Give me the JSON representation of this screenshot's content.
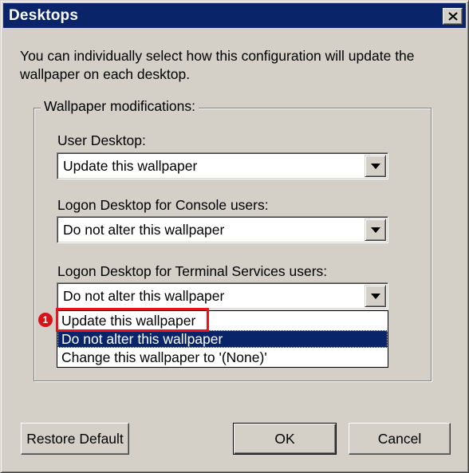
{
  "window": {
    "title": "Desktops"
  },
  "description": "You can individually select how this configuration will update the wallpaper on each desktop.",
  "group": {
    "label": "Wallpaper modifications:"
  },
  "fields": [
    {
      "label": "User Desktop:",
      "value": "Update this wallpaper"
    },
    {
      "label": "Logon Desktop for Console users:",
      "value": "Do not alter this wallpaper"
    },
    {
      "label": "Logon Desktop for Terminal Services users:",
      "value": "Do not alter this wallpaper"
    }
  ],
  "dropdown": {
    "options": [
      "Update this wallpaper",
      "Do not alter this wallpaper",
      "Change this wallpaper to '(None)'"
    ],
    "selected": "Do not alter this wallpaper",
    "highlighted": "Update this wallpaper"
  },
  "annotation": {
    "marker": "1",
    "color": "#e8141c"
  },
  "buttons": {
    "restore": "Restore Default",
    "ok": "OK",
    "cancel": "Cancel"
  },
  "colors": {
    "titlebar": "#0a246a",
    "face": "#d4d0c8",
    "selection": "#0a246a"
  }
}
